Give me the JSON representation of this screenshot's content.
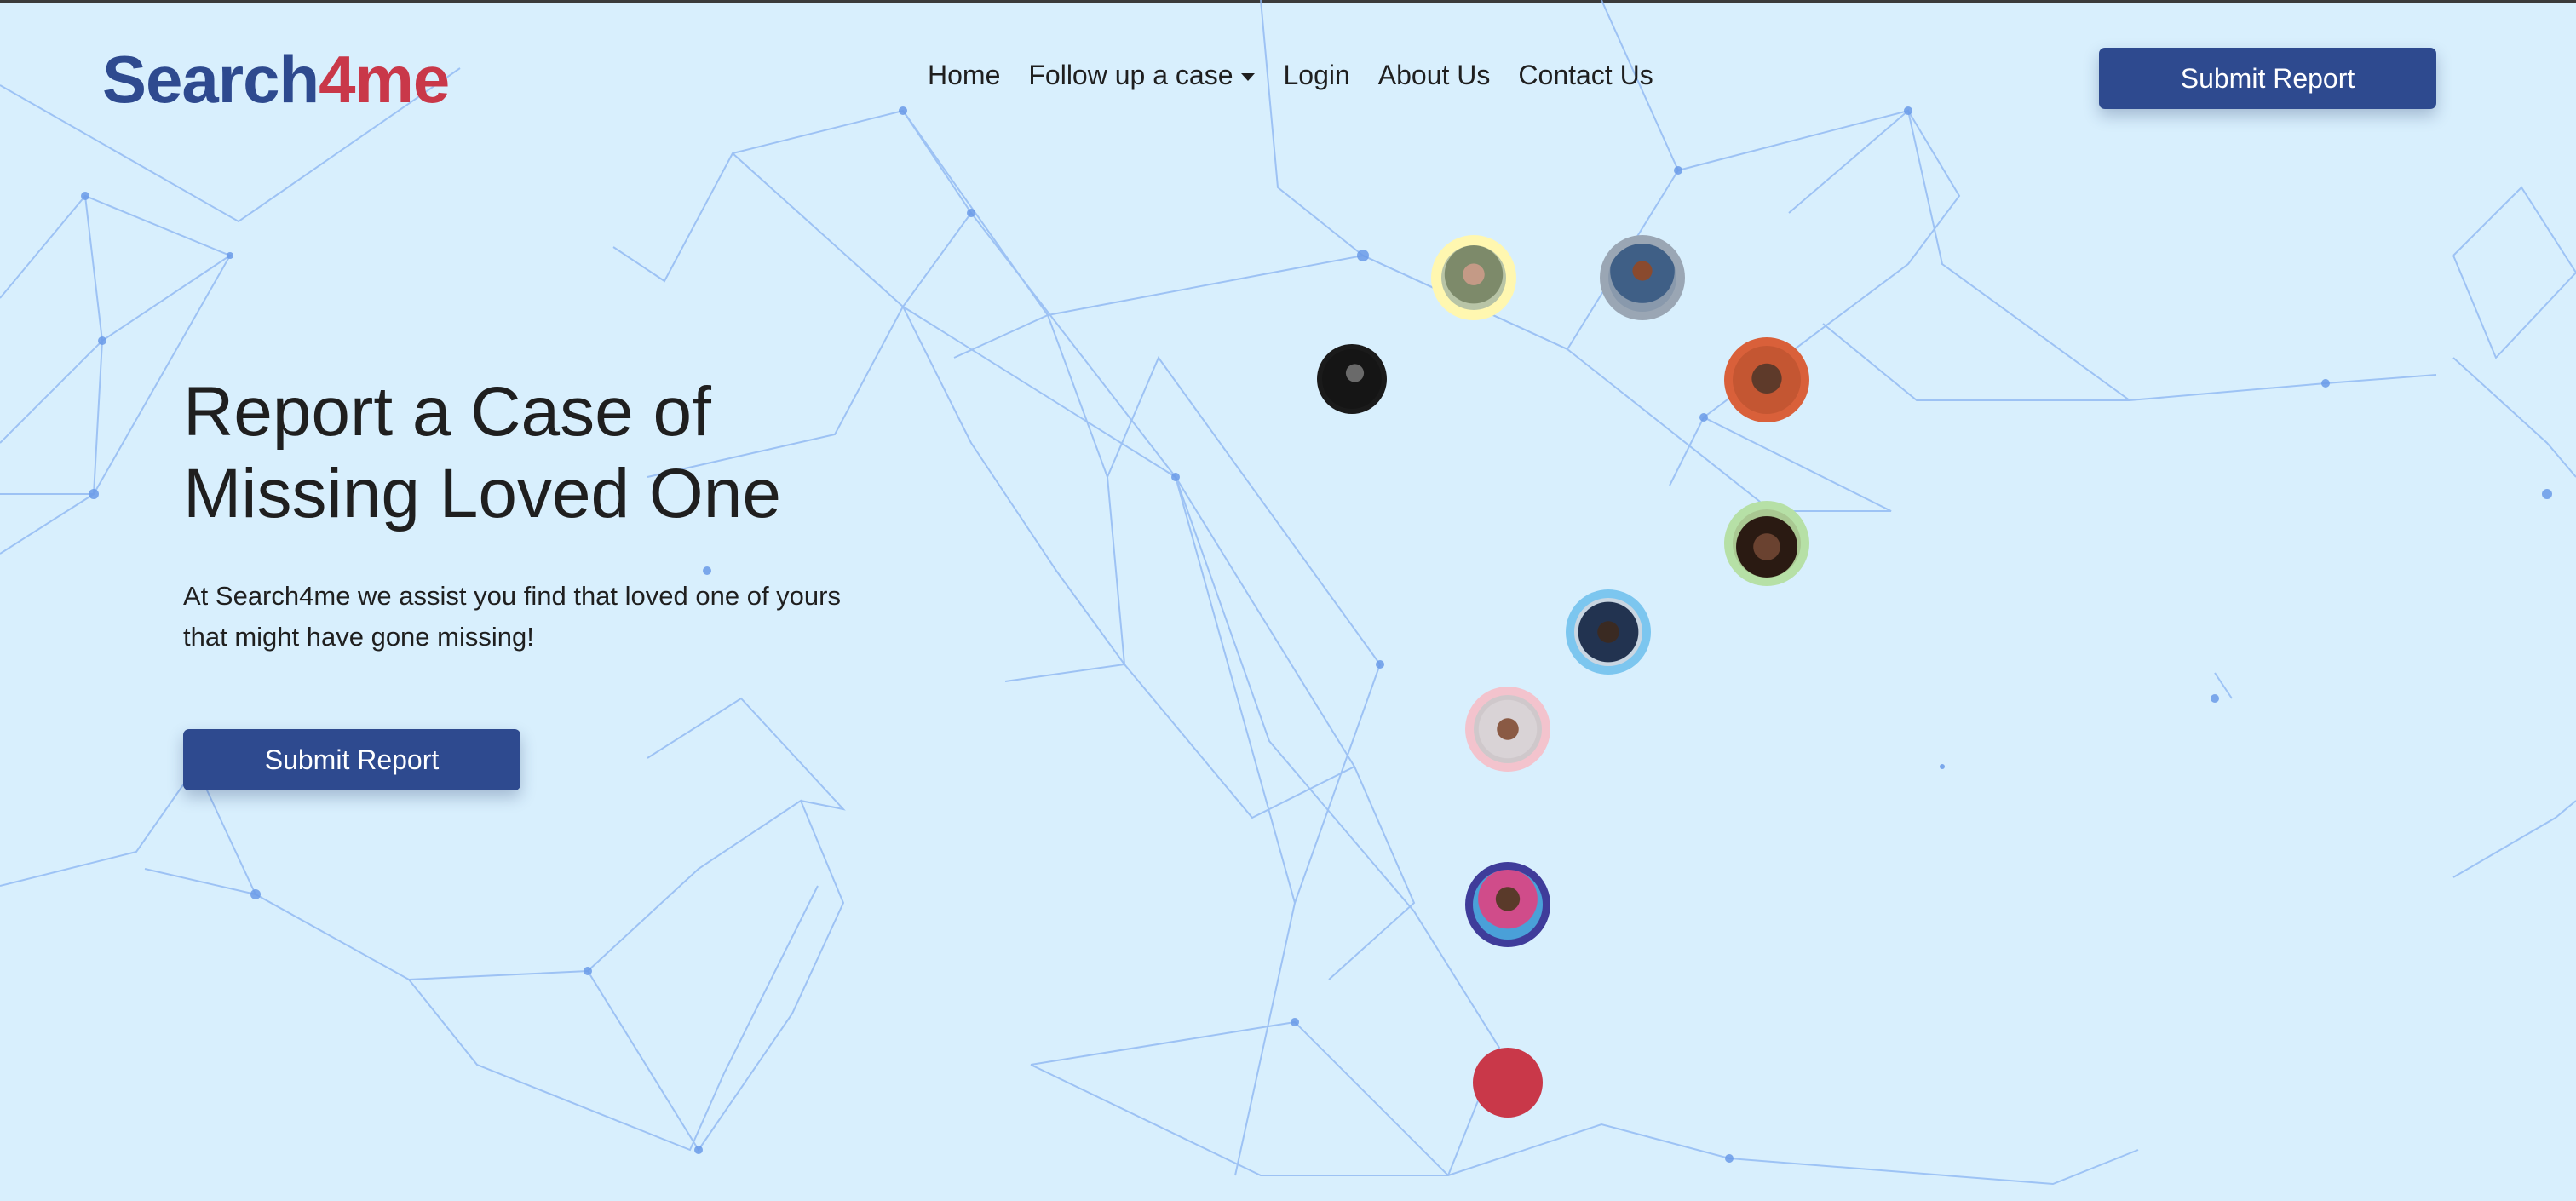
{
  "brand": {
    "logo_part1": "Search",
    "logo_part2": "4me",
    "primary_color": "#2e4a8f",
    "accent_color": "#c93849",
    "background_color": "#d8effd"
  },
  "nav": {
    "items": [
      {
        "label": "Home"
      },
      {
        "label": "Follow up a case",
        "dropdown": true
      },
      {
        "label": "Login"
      },
      {
        "label": "About Us"
      },
      {
        "label": "Contact Us"
      }
    ],
    "cta_label": "Submit Report"
  },
  "hero": {
    "title": "Report a Case of Missing Loved One",
    "subtitle": "At Search4me we assist you find that loved one of yours that might have gone missing!",
    "cta_label": "Submit Report"
  },
  "avatars": [
    {
      "name": "person-photo",
      "ring_color": "#fff7b0"
    },
    {
      "name": "person-photo",
      "ring_color": "#9aa6b4"
    },
    {
      "name": "person-photo",
      "ring_color": "#1a1a1a"
    },
    {
      "name": "person-photo",
      "ring_color": "#d9603a"
    },
    {
      "name": "person-photo",
      "ring_color": "#b6e0a6"
    },
    {
      "name": "person-photo",
      "ring_color": "#7cc6ef"
    },
    {
      "name": "person-photo",
      "ring_color": "#f3c3cd"
    },
    {
      "name": "person-photo",
      "ring_color": "#3f3c9a"
    },
    {
      "name": "red-dot",
      "ring_color": "#c93849"
    }
  ]
}
